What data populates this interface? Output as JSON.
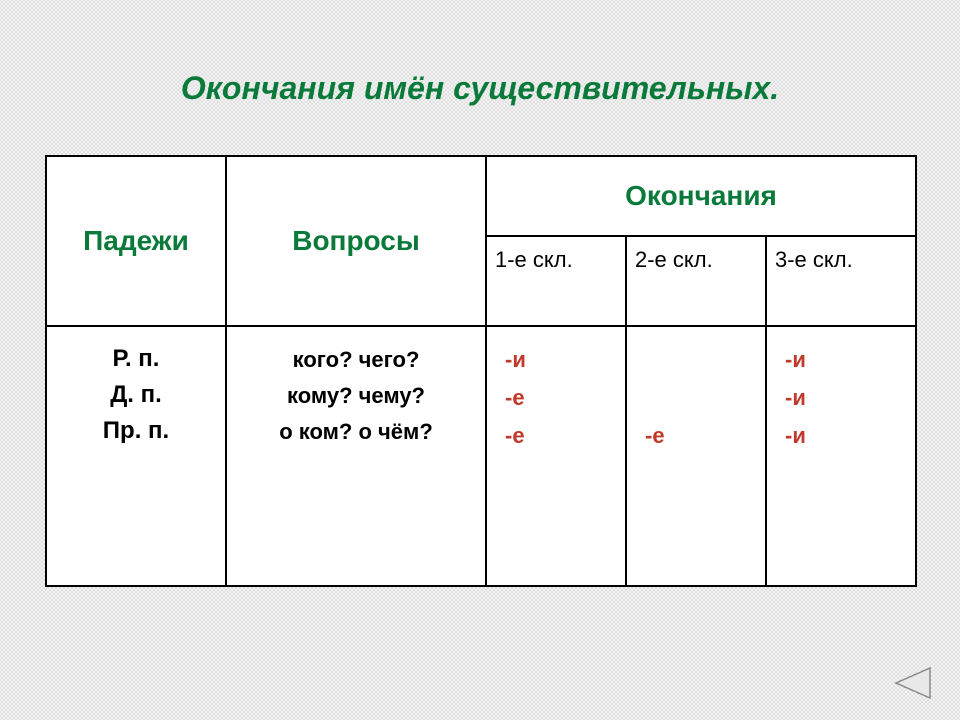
{
  "title": "Окончания имён существительных.",
  "headers": {
    "col1": "Падежи",
    "col2": "Вопросы",
    "col3_main": "Окончания",
    "sub1": "1-е скл.",
    "sub2": "2-е скл.",
    "sub3": "3-е скл."
  },
  "cases": {
    "r": "Р. п.",
    "d": "Д. п.",
    "p": "Пр. п."
  },
  "questions": {
    "r": "кого? чего?",
    "d": "кому? чему?",
    "p": "о ком? о чём?"
  },
  "endings": {
    "d1": {
      "r": "-и",
      "d": "-е",
      "p": "-е"
    },
    "d2": {
      "r": "",
      "d": "",
      "p": "-е"
    },
    "d3": {
      "r": "-и",
      "d": "-и",
      "p": "-и"
    }
  },
  "nav": {
    "back": "back"
  }
}
